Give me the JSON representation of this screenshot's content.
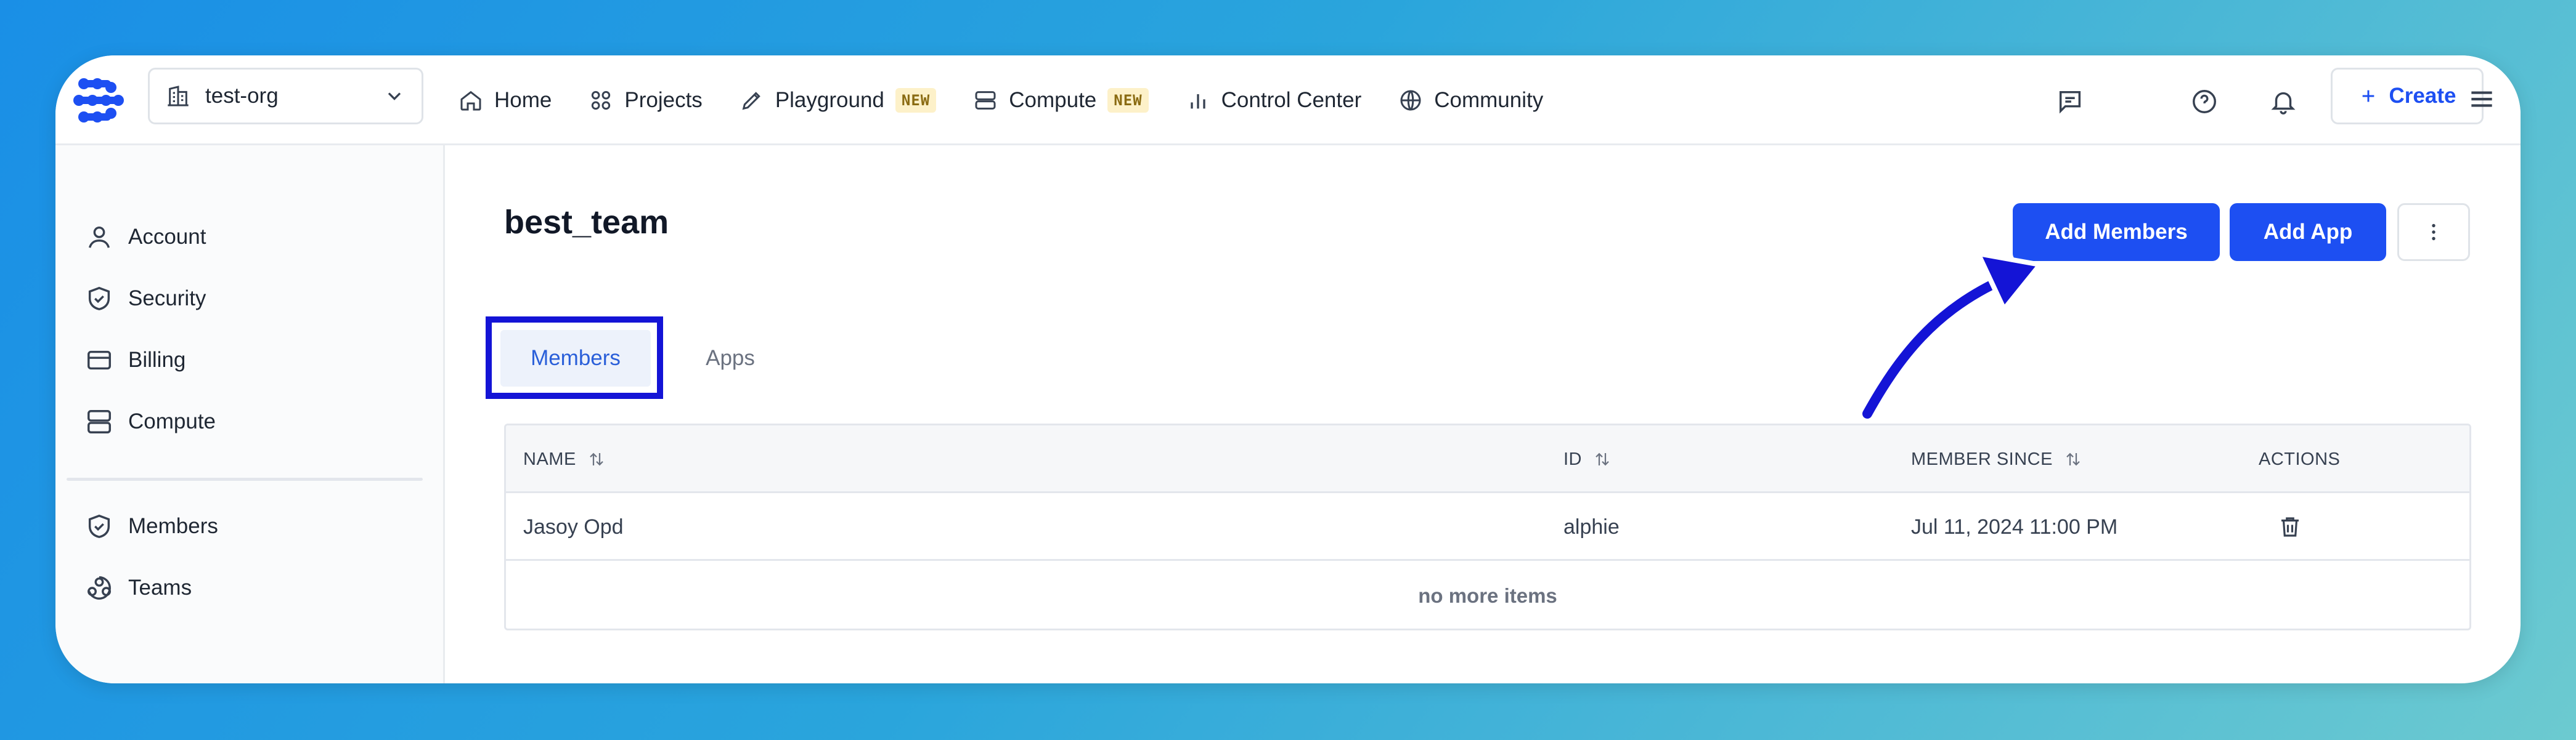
{
  "org": {
    "name": "test-org"
  },
  "nav": {
    "items": [
      {
        "label": "Home",
        "icon": "home-icon"
      },
      {
        "label": "Projects",
        "icon": "projects-icon"
      },
      {
        "label": "Playground",
        "icon": "pencil-icon",
        "badge": "NEW"
      },
      {
        "label": "Compute",
        "icon": "server-icon",
        "badge": "NEW"
      },
      {
        "label": "Control Center",
        "icon": "bar-chart-icon"
      },
      {
        "label": "Community",
        "icon": "globe-icon"
      }
    ],
    "create_label": "Create"
  },
  "sidebar": {
    "items": [
      {
        "label": "Account",
        "icon": "user-icon"
      },
      {
        "label": "Security",
        "icon": "shield-check-icon"
      },
      {
        "label": "Billing",
        "icon": "credit-card-icon"
      },
      {
        "label": "Compute",
        "icon": "server-icon"
      },
      {
        "label": "Members",
        "icon": "shield-check-icon"
      },
      {
        "label": "Teams",
        "icon": "teams-icon"
      }
    ]
  },
  "page": {
    "title": "best_team",
    "add_members_label": "Add Members",
    "add_app_label": "Add App"
  },
  "tabs": [
    {
      "label": "Members",
      "active": true
    },
    {
      "label": "Apps",
      "active": false
    }
  ],
  "table": {
    "columns": [
      "NAME",
      "ID",
      "MEMBER SINCE",
      "ACTIONS"
    ],
    "rows": [
      {
        "name": "Jasoy Opd",
        "id": "alphie",
        "member_since": "Jul 11, 2024 11:00 PM"
      }
    ],
    "footer": "no more items"
  },
  "colors": {
    "accent": "#1d4ff2",
    "annotation": "#1414d6",
    "badge_bg": "#fdf1c9"
  }
}
